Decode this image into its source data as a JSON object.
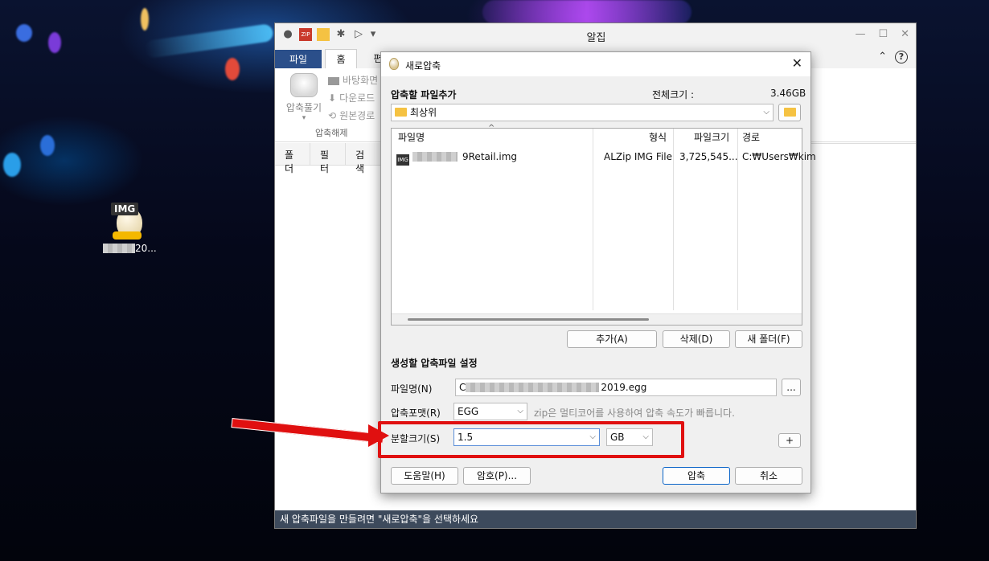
{
  "desktop": {
    "icon_badge": "IMG",
    "icon_label": "20..."
  },
  "main_window": {
    "title": "알집",
    "tabs": [
      "파일",
      "홈",
      "편"
    ],
    "ribbon": {
      "big_button": "압축풀기",
      "small_items": [
        "바탕화면",
        "다운로드",
        "원본경로"
      ],
      "group_label": "압축해제"
    },
    "side_tabs": [
      "폴더",
      "필터",
      "검색"
    ],
    "status": "새 압축파일을 만들려면 \"새로압축\"을 선택하세요"
  },
  "dialog": {
    "title": "새로압축",
    "add_section": "압축할 파일추가",
    "total_size_label": "전체크기 :",
    "total_size": "3.46GB",
    "location": "최상위",
    "columns": [
      "파일명",
      "형식",
      "파일크기",
      "경로"
    ],
    "rows": [
      {
        "name_visible": "9Retail.img",
        "type": "ALZip IMG File",
        "size": "3,725,545...",
        "path": "C:₩Users₩kim"
      }
    ],
    "file_icon_text": "IMG",
    "buttons": {
      "add": "추가(A)",
      "delete": "삭제(D)",
      "new_folder": "새 폴더(F)",
      "help": "도움말(H)",
      "password": "암호(P)...",
      "compress": "압축",
      "cancel": "취소",
      "browse": "...",
      "plus": "+"
    },
    "settings_section": "생성할 압축파일 설정",
    "filename_label": "파일명(N)",
    "filename_value_start": "C",
    "filename_value_end": "2019.egg",
    "format_label": "압축포맷(R)",
    "format_value": "EGG",
    "format_hint": "zip은 멀티코어를 사용하여 압축 속도가 빠릅니다.",
    "split_label": "분할크기(S)",
    "split_value": "1.5",
    "split_unit": "GB"
  },
  "colors": {
    "annotation": "#e01010",
    "status_bar": "#3d4a5c",
    "file_tab": "#2b4f8a"
  }
}
